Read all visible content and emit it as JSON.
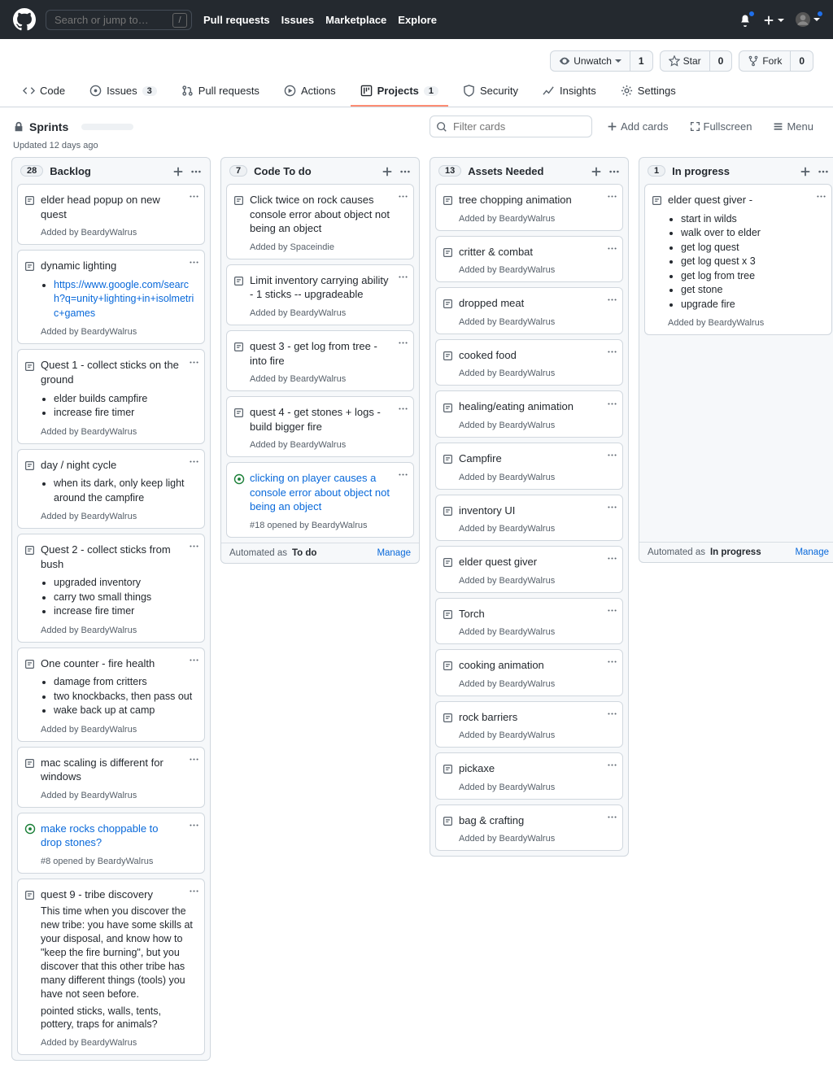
{
  "header": {
    "search_placeholder": "Search or jump to…",
    "nav": {
      "pulls": "Pull requests",
      "issues": "Issues",
      "marketplace": "Marketplace",
      "explore": "Explore"
    }
  },
  "repo": {
    "unwatch": "Unwatch",
    "unwatch_count": "1",
    "star": "Star",
    "star_count": "0",
    "fork": "Fork",
    "fork_count": "0"
  },
  "tabs": {
    "code": "Code",
    "issues": "Issues",
    "issues_count": "3",
    "pulls": "Pull requests",
    "actions": "Actions",
    "projects": "Projects",
    "projects_count": "1",
    "security": "Security",
    "insights": "Insights",
    "settings": "Settings"
  },
  "project": {
    "title": "Sprints",
    "updated": "Updated 12 days ago",
    "filter_placeholder": "Filter cards",
    "add_cards": "Add cards",
    "fullscreen": "Fullscreen",
    "menu": "Menu"
  },
  "foot": {
    "automated": "Automated as",
    "manage": "Manage",
    "todo": "To do",
    "inprog": "In progress"
  },
  "added_by": "Added by",
  "cols": {
    "backlog": {
      "count": "28",
      "name": "Backlog"
    },
    "code": {
      "count": "7",
      "name": "Code To do"
    },
    "assets": {
      "count": "13",
      "name": "Assets Needed"
    },
    "prog": {
      "count": "1",
      "name": "In progress"
    }
  },
  "c": {
    "b1": {
      "t": "elder head popup on new quest",
      "u": "BeardyWalrus"
    },
    "b2": {
      "t": "dynamic lighting",
      "url": "https://www.google.com/search?q=unity+lighting+in+isolmetric+games",
      "u": "BeardyWalrus"
    },
    "b3": {
      "t": "Quest 1 - collect sticks on the ground",
      "li1": "elder builds campfire",
      "li2": "increase fire timer",
      "u": "BeardyWalrus"
    },
    "b4": {
      "t": "day / night cycle",
      "li1": "when its dark, only keep light around the campfire",
      "u": "BeardyWalrus"
    },
    "b5": {
      "t": "Quest 2 - collect sticks from bush",
      "li1": "upgraded inventory",
      "li2": "carry two small things",
      "li3": "increase fire timer",
      "u": "BeardyWalrus"
    },
    "b6": {
      "t": "One counter - fire health",
      "li1": "damage from critters",
      "li2": "two knockbacks, then pass out",
      "li3": "wake back up at camp",
      "u": "BeardyWalrus"
    },
    "b7": {
      "t": "mac scaling is different for windows",
      "u": "BeardyWalrus"
    },
    "b8": {
      "t": "make rocks choppable to drop stones?",
      "sub": "#8 opened by BeardyWalrus"
    },
    "b9": {
      "t": "quest 9 - tribe discovery",
      "d1": "This time when you discover the new tribe: you have some skills at your disposal, and know how to \"keep the fire burning\", but you discover that this other tribe has many different things (tools) you have not seen before.",
      "d2": "pointed sticks, walls, tents, pottery, traps for animals?",
      "u": "BeardyWalrus"
    },
    "c1": {
      "t": "Click twice on rock causes console error about object not being an object",
      "u": "Spaceindie"
    },
    "c2": {
      "t": "Limit inventory carrying ability - 1 sticks -- upgradeable",
      "u": "BeardyWalrus"
    },
    "c3": {
      "t": "quest 3 - get log from tree - into fire",
      "u": "BeardyWalrus"
    },
    "c4": {
      "t": "quest 4 - get stones + logs - build bigger fire",
      "u": "BeardyWalrus"
    },
    "c5": {
      "t": "clicking on player causes a console error about object not being an object",
      "sub": "#18 opened by BeardyWalrus"
    },
    "a1": {
      "t": "tree chopping animation",
      "u": "BeardyWalrus"
    },
    "a2": {
      "t": "critter & combat",
      "u": "BeardyWalrus"
    },
    "a3": {
      "t": "dropped meat",
      "u": "BeardyWalrus"
    },
    "a4": {
      "t": "cooked food",
      "u": "BeardyWalrus"
    },
    "a5": {
      "t": "healing/eating animation",
      "u": "BeardyWalrus"
    },
    "a6": {
      "t": "Campfire",
      "u": "BeardyWalrus"
    },
    "a7": {
      "t": "inventory UI",
      "u": "BeardyWalrus"
    },
    "a8": {
      "t": "elder quest giver",
      "u": "BeardyWalrus"
    },
    "a9": {
      "t": "Torch",
      "u": "BeardyWalrus"
    },
    "a10": {
      "t": "cooking animation",
      "u": "BeardyWalrus"
    },
    "a11": {
      "t": "rock barriers",
      "u": "BeardyWalrus"
    },
    "a12": {
      "t": "pickaxe",
      "u": "BeardyWalrus"
    },
    "a13": {
      "t": "bag & crafting",
      "u": "BeardyWalrus"
    },
    "p1": {
      "t": "elder quest giver -",
      "li1": "start in wilds",
      "li2": "walk over to elder",
      "li3": "get log quest",
      "li4": "get log quest x 3",
      "li5": "get log from tree",
      "li6": "get stone",
      "li7": "upgrade fire",
      "u": "BeardyWalrus"
    }
  }
}
